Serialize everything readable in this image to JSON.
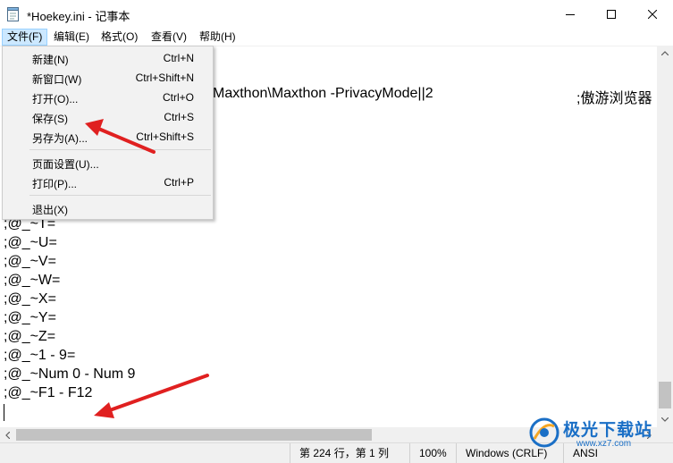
{
  "window": {
    "title": "*Hoekey.ini - 记事本"
  },
  "menubar": {
    "items": [
      {
        "label": "文件(F)"
      },
      {
        "label": "编辑(E)"
      },
      {
        "label": "格式(O)"
      },
      {
        "label": "查看(V)"
      },
      {
        "label": "帮助(H)"
      }
    ]
  },
  "file_menu": {
    "items": [
      {
        "label": "新建(N)",
        "shortcut": "Ctrl+N"
      },
      {
        "label": "新窗口(W)",
        "shortcut": "Ctrl+Shift+N"
      },
      {
        "label": "打开(O)...",
        "shortcut": "Ctrl+O"
      },
      {
        "label": "保存(S)",
        "shortcut": "Ctrl+S"
      },
      {
        "label": "另存为(A)...",
        "shortcut": "Ctrl+Shift+S"
      },
      {
        "label": "页面设置(U)...",
        "shortcut": ""
      },
      {
        "label": "打印(P)...",
        "shortcut": "Ctrl+P"
      },
      {
        "label": "退出(X)",
        "shortcut": ""
      }
    ]
  },
  "editor": {
    "top_line_text": "Maxthon\\Maxthon -PrivacyMode||2",
    "top_line_comment": ";傲游浏览器",
    "lines": [
      ";@_~T=",
      ";@_~U=",
      ";@_~V=",
      ";@_~W=",
      ";@_~X=",
      ";@_~Y=",
      ";@_~Z=",
      ";@_~1 - 9=",
      ";@_~Num 0 - Num 9",
      ";@_~F1 - F12"
    ]
  },
  "statusbar": {
    "position": "第 224 行，第 1 列",
    "zoom": "100%",
    "line_ending": "Windows (CRLF)",
    "encoding": "ANSI"
  },
  "watermark": {
    "brand": "极光下载站",
    "url": "www.xz7.com"
  },
  "colors": {
    "menu_active_bg": "#cce8ff",
    "arrow_red": "#e02020",
    "watermark_blue": "#1a6fc6"
  }
}
